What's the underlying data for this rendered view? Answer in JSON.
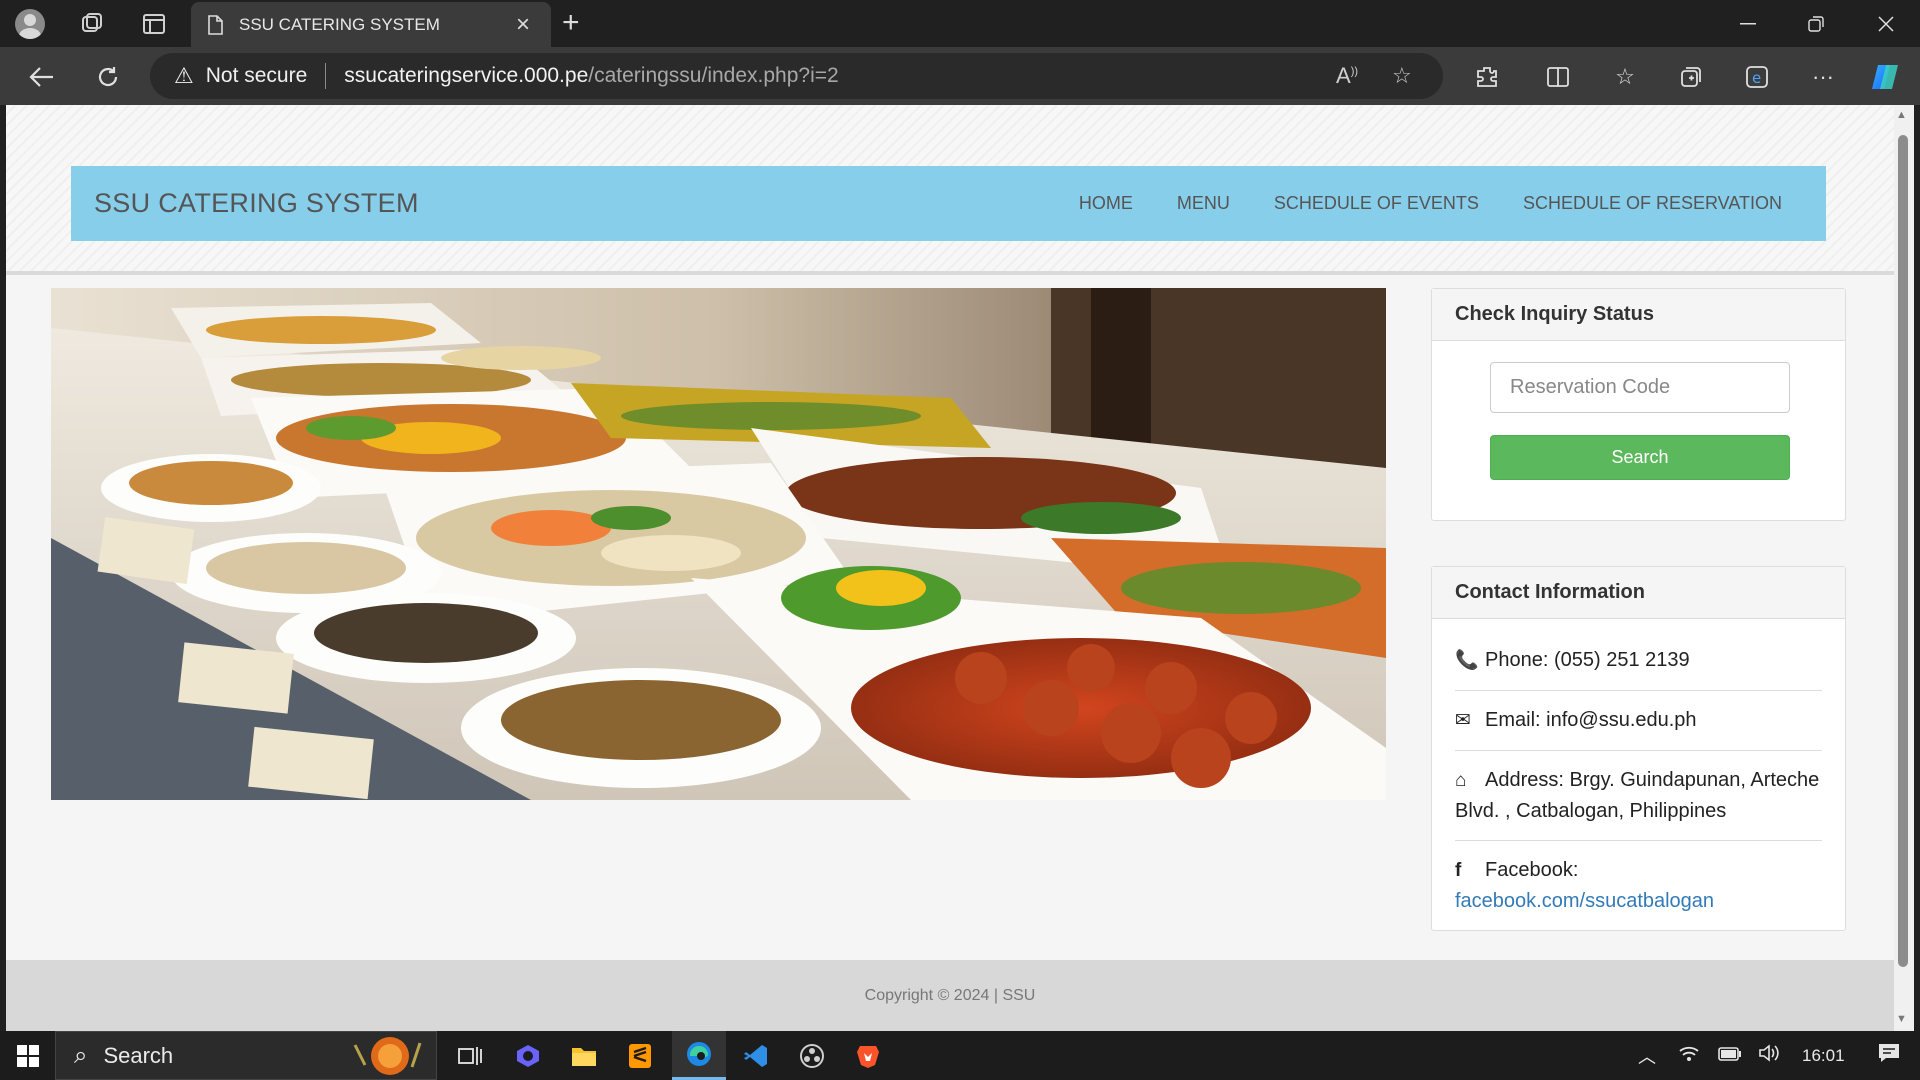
{
  "browser": {
    "tab_title": "SSU CATERING SYSTEM",
    "security_label": "Not secure",
    "url_host": "ssucateringservice.000.pe",
    "url_path": "/cateringssu/index.php?i=2"
  },
  "site": {
    "brand": "SSU CATERING SYSTEM",
    "nav": [
      "HOME",
      "MENU",
      "SCHEDULE OF EVENTS",
      "SCHEDULE OF RESERVATION"
    ]
  },
  "inquiry": {
    "title": "Check Inquiry Status",
    "placeholder": "Reservation Code",
    "button": "Search"
  },
  "contact": {
    "title": "Contact Information",
    "phone_label": "Phone:",
    "phone": "(055) 251 2139",
    "email_label": "Email:",
    "email": "info@ssu.edu.ph",
    "address_label": "Address:",
    "address": "Brgy. Guindapunan, Arteche Blvd. , Catbalogan, Philippines",
    "facebook_label": "Facebook:",
    "facebook_link": "facebook.com/ssucatbalogan"
  },
  "footer": {
    "copyright": "Copyright © 2024 | SSU"
  },
  "taskbar": {
    "search_label": "Search",
    "clock": "16:01"
  },
  "colors": {
    "navbar": "#87ceeb",
    "search_button": "#5cb85c",
    "link": "#337ab7"
  }
}
